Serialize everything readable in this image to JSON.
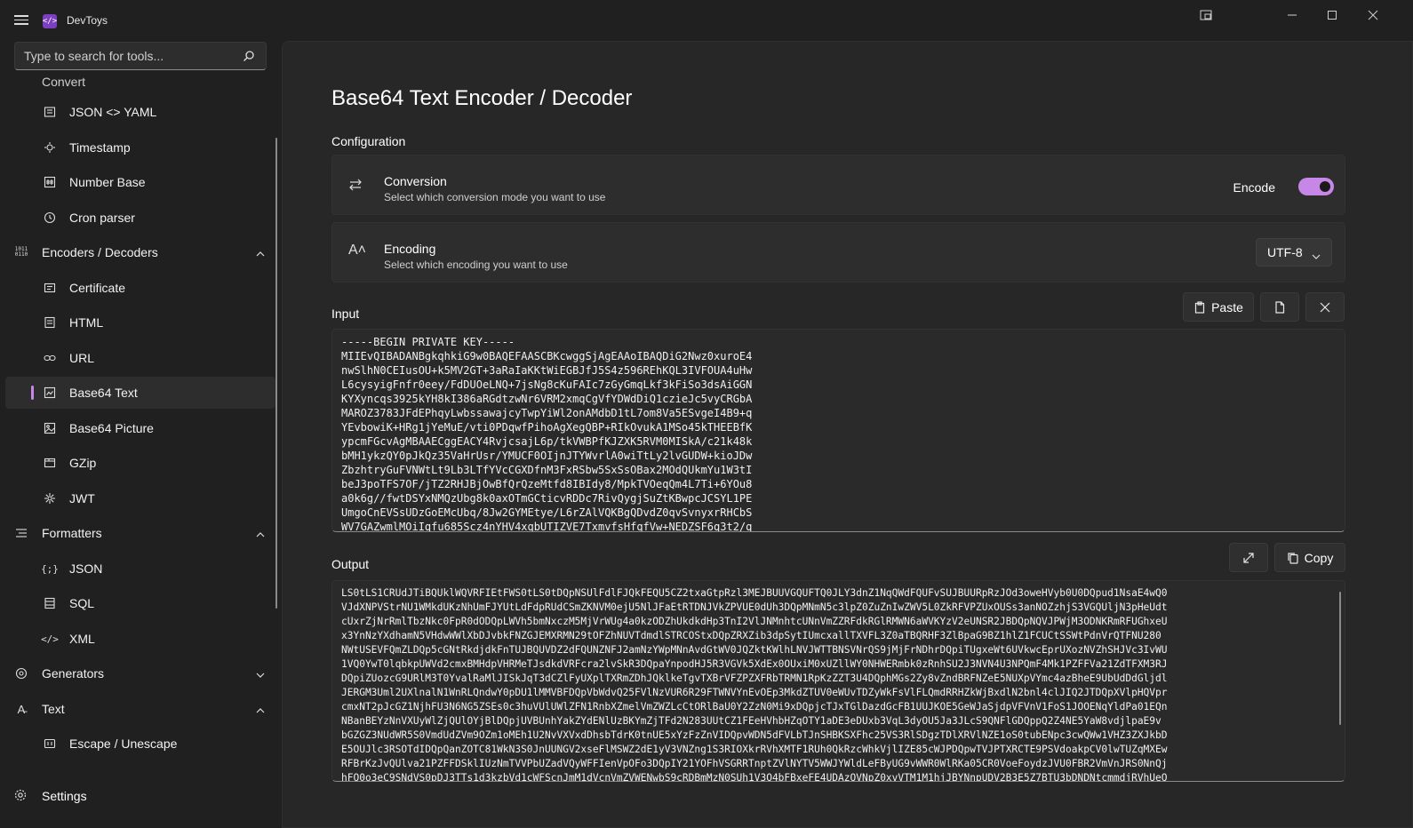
{
  "app": {
    "title": "DevToys",
    "logo_glyph": "</>"
  },
  "search": {
    "placeholder": "Type to search for tools..."
  },
  "sidebar": {
    "partial_item": "Convert",
    "items": [
      {
        "label": "JSON <> YAML",
        "icon": "json-yaml-icon",
        "type": "child"
      },
      {
        "label": "Timestamp",
        "icon": "timestamp-icon",
        "type": "child"
      },
      {
        "label": "Number Base",
        "icon": "number-base-icon",
        "type": "child"
      },
      {
        "label": "Cron parser",
        "icon": "cron-icon",
        "type": "child"
      },
      {
        "label": "Encoders / Decoders",
        "icon": "binary-icon",
        "type": "group",
        "expanded": true
      },
      {
        "label": "Certificate",
        "icon": "certificate-icon",
        "type": "child"
      },
      {
        "label": "HTML",
        "icon": "html-icon",
        "type": "child"
      },
      {
        "label": "URL",
        "icon": "link-icon",
        "type": "child"
      },
      {
        "label": "Base64 Text",
        "icon": "base64-text-icon",
        "type": "child",
        "selected": true
      },
      {
        "label": "Base64 Picture",
        "icon": "base64-picture-icon",
        "type": "child"
      },
      {
        "label": "GZip",
        "icon": "gzip-icon",
        "type": "child"
      },
      {
        "label": "JWT",
        "icon": "jwt-icon",
        "type": "child"
      },
      {
        "label": "Formatters",
        "icon": "formatters-icon",
        "type": "group",
        "expanded": true
      },
      {
        "label": "JSON",
        "icon": "json-icon",
        "type": "child"
      },
      {
        "label": "SQL",
        "icon": "sql-icon",
        "type": "child"
      },
      {
        "label": "XML",
        "icon": "xml-icon",
        "type": "child"
      },
      {
        "label": "Generators",
        "icon": "generators-icon",
        "type": "group",
        "expanded": false
      },
      {
        "label": "Text",
        "icon": "text-icon",
        "type": "group",
        "expanded": true
      },
      {
        "label": "Escape / Unescape",
        "icon": "escape-icon",
        "type": "child"
      }
    ],
    "settings_label": "Settings"
  },
  "main": {
    "title": "Base64 Text Encoder / Decoder",
    "config_label": "Configuration",
    "conversion": {
      "title": "Conversion",
      "subtitle": "Select which conversion mode you want to use",
      "toggle_label": "Encode",
      "toggle_on": true
    },
    "encoding": {
      "title": "Encoding",
      "subtitle": "Select which encoding you want to use",
      "selected": "UTF-8"
    },
    "input": {
      "label": "Input",
      "paste_label": "Paste",
      "lines": [
        "-----BEGIN PRIVATE KEY-----",
        "MIIEvQIBADANBgkqhkiG9w0BAQEFAASCBKcwggSjAgEAAoIBAQDiG2Nwz0xuroE4",
        "nwSlhN0CEIusOU+k5MV2GT+3aRaIaKKtWiEGBJfJ5S4z596REhKQL3IVFOUA4uHw",
        "L6cysyigFnfr0eey/FdDUOeLNQ+7jsNg8cKuFAIc7zGyGmqLkf3kFiSo3dsAiGGN",
        "KYXyncqs3925kYH8kI386aRGdtzwNr6VRM2xmqCgVfYDWdDiQ1czieJc5vyCRGbA",
        "MAROZ3783JFdEPhqyLwbssawajcyTwpYiWl2onAMdbD1tL7om8Va5ESvgeI4B9+q",
        "YEvbowiK+HRg1jYeMuE/vti0PDqwfPihoAgXegQBP+RIkOvukA1MSo45kTHEEBfK",
        "ypcmFGcvAgMBAAECggEACY4RvjcsajL6p/tkVWBPfKJZXK5RVM0MISkA/c21k48k",
        "bMH1ykzQY0pJkQz35VaHrUsr/YMUCF0OIjnJTYWvrlA0wiTtLy2lvGUDW+kioJDw",
        "ZbzhtryGuFVNWtLt9Lb3LTfYVcCGXDfnM3FxRSbw5SxSsOBax2MOdQUkmYu1W3tI",
        "beJ3poTFS7OF/jTZ2RHJBjOwBfQrQzeMtfd8IBIdy8/MpkTVOeqQm4L7Ti+6YOu8",
        "a0k6g//fwtDSYxNMQzUbg8k0axOTmGCticvRDDc7RivQygjSuZtKBwpcJCSYL1PE",
        "UmgoCnEVSsUDzGoEMcUbq/8Jw2GYMEtye/L6rZAlVQKBgQDvdZ0qvSvnyxrRHCbS",
        "WV7GAZwmlMOiIqfu685Scz4nYHV4xqbUTIZVE7TxmvfsHfqfVw+NEDZSF6q3t2/q"
      ]
    },
    "output": {
      "label": "Output",
      "copy_label": "Copy",
      "lines": [
        "LS0tLS1CRUdJTiBQUklWQVRFIEtFWS0tLS0tDQpNSUlFdlFJQkFEQU5CZ2txaGtpRzl3MEJBUUVGQUFTQ0JLY3dnZ1NqQWdFQUFvSUJBUURpRzJOd3oweHVyb0U0DQpud1NsaE4wQ0",
        "VJdXNPVStrNU1WMkdUKzNhUmFJYUtLdFdpRUdCSmZKNVM0ejU5NlJFaEtRTDNJVkZPVUE0dUh3DQpMNmN5c3lpZ0ZuZnIwZWV5L0ZkRFVPZUxOUSs3anNOZzhjS3VGQUljN3pHeUdt",
        "cUxrZjNrRmlTbzNkc0FpR0dODQpLWVh5bmNxczM5MjVrWUg4a0kzODZhUkdkdHp3TnI2VlJNMnhtcUNnVmZZRFdkRGlRMWN6aWVKYzV2eUNSR2JBDQpNQVJPWjM3ODNKRmRFUGhxeU",
        "x3YnNzYXdhamN5VHdwWWlXbDJvbkFNZGJEMXRMN29tOFZhNUVTdmdlSTRCOStxDQpZRXZib3dpSytIUmcxallTXVFL3Z0aTBQRHF3ZlBpaG9BZ1hlZ1FCUCtSSWtPdnVrQTFNU280",
        "NWtUSEVFQmZLDQp5cGNtRkdjdkFnTUJBQUVDZ2dFQUNZNFJ2amNzYWpMNnAvdGtWV0JQZktKWlhLNVJWTTBNSVNrQS9jMjFrNDhrDQpiTUgxeWt6UVkwcEprUXozNVZhSHJVc3IvWU",
        "1VQ0YwT0lqbkpUWVd2cmxBMHdpVHRMeTJsdkdVRFcra2lvSkR3DQpaYnpodHJ5R3VGVk5XdEx0OUxiM0xUZllWY0NHWERmbk0zRnhSU2J3NVN4U3NPQmF4Mk1PZFFVa21ZdTFXM3RJ",
        "DQpiZUozcG9URlM3T0YvalRaMlJISkJqT3dCZlFyUXplTXRmZDhJQklkeTgvTXBrVFZPZXFRbTRMN1RpKzZZT3U4DQphMGs2Zy8vZndBRFNZeE5NUXpVYmc4azBheE9UbUdDdGljdl",
        "JERGM3Uml2UXlnalN1WnRLQndwY0pDU1lMMVBFDQpVbWdvQ25FVlNzVUR6R29FTWNVYnEvOEp3MkdZTUV0eWUvTDZyWkFsVlFLQmdRRHZkWjBxdlN2bnl4clJIQ2JTDQpXVlpHQVpr",
        "cmxNT2pJcGZ1NjhFU3N6NG5ZSEs0c3huVUlUWlZFN1RnbXZmelVmZWZLcCtORlBaU0Y2ZzN0Mi9xDQpjcTJxTGlDazdGcFB1UUJKOE5GeWJaSjdpVFVnV1FoS1JOOENqYldPa01EQn",
        "NBanBEYzNnVXUyWlZjQUlOYjBlDQpjUVBUnhYakZYdENlUzBKYmZjTFd2N283UUtCZ1FEeHVhbHZqOTY1aDE3eDUxb3VqL3dyOU5Ja3JLcS9QNFlGDQppQ2Z4NE5YaW8vdjlpaE9v",
        "bGZGZ3NUdWR5S0VmdUdZVm9OZm1oMEh1U2NvVXVxdDhsbTdrK0tnUE5xYzFzZnVIDQpvWDN5dFVLbTJnSHBKSXFhc25VS3RlSDgzTDlXRVlNZE1oS0tubENpc3cwQWw1VHZ3ZXJkbD",
        "E5OUJlc3RSOTdIDQpQanZOTC81WkN3S0JnUUNGV2xseFlMSWZ2dE1yV3VNZng1S3RIOXkrRVhXMTF1RUh0QkRzcWhkVjlIZE85cWJPDQpwTVJPTXRCTE9PSVdoakpCV0lwTUZqMXEw",
        "RFBrKzJvQUlva21PZFFDSklIUzNmTVVPbUZadVQyWFFIenVpOFo3DQpIY21YOFhVSGRRTnptZVlNYTV5WWJYWldLeFByUG9vWWR0WlRKa05CR0VoeFoydzJVU0FBR2VmVnJRS0NnQj",
        "hFQ0o3eC9SNdVS0pDJ3TTs1d3kzbVd1cWFScnJmM1dVcnVmZVWENwbS9cRDBmMzN0SUh1V3Q4bFBxeFE4UDAzQVNpZ0xvVTM1M1hjJBYNnpUDV2B3E5Z7BTU3bDNDNtcmmdjRVhUeQ"
      ]
    }
  },
  "colors": {
    "accent": "#c687e6",
    "background": "#202020",
    "panel": "#272727",
    "card": "#2d2d2d"
  }
}
